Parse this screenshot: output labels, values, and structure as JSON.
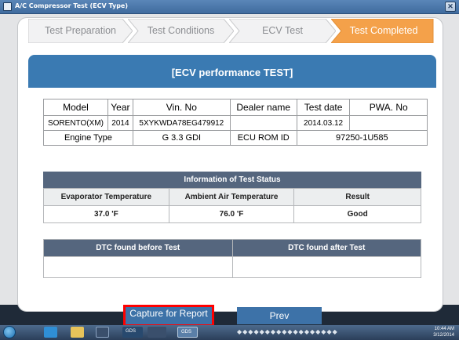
{
  "window": {
    "title": "A/C Compressor Test (ECV Type)",
    "close_glyph": "✕"
  },
  "steps": [
    {
      "label": "Test Preparation",
      "active": false
    },
    {
      "label": "Test Conditions",
      "active": false
    },
    {
      "label": "ECV Test",
      "active": false
    },
    {
      "label": "Test Completed",
      "active": true
    }
  ],
  "header": {
    "title": "[ECV performance TEST]"
  },
  "vehicle_info": {
    "headers": {
      "model": "Model",
      "year": "Year",
      "vin": "Vin. No",
      "dealer": "Dealer name",
      "test_date": "Test date",
      "pwa": "PWA. No"
    },
    "values": {
      "model": "SORENTO(XM)",
      "year": "2014",
      "vin": "5XYKWDA78EG479912",
      "dealer": "",
      "test_date": "2014.03.12",
      "pwa": ""
    },
    "engine_type_label": "Engine Type",
    "engine_type": "G 3.3 GDI",
    "ecu_rom_label": "ECU ROM ID",
    "ecu_rom_id": "97250-1U585"
  },
  "test_status": {
    "title": "Information of Test Status",
    "headers": {
      "evaporator": "Evaporator Temperature",
      "ambient": "Ambient Air Temperature",
      "result": "Result"
    },
    "values": {
      "evaporator": "37.0 'F",
      "ambient": "76.0 'F",
      "result": "Good"
    }
  },
  "dtc": {
    "before_label": "DTC found before Test",
    "after_label": "DTC found after Test",
    "before_value": "",
    "after_value": ""
  },
  "buttons": {
    "capture": "Capture for Report",
    "prev": "Prev"
  },
  "taskbar": {
    "gds_label_1": "GDS",
    "gds_label_2": "GDS",
    "clock_time": "10:44 AM",
    "clock_date": "3/12/2014"
  },
  "colors": {
    "accent": "#3a7ab2",
    "active_step": "#f4a14a",
    "table_header": "#55667e",
    "highlight_border": "#ff0000"
  }
}
